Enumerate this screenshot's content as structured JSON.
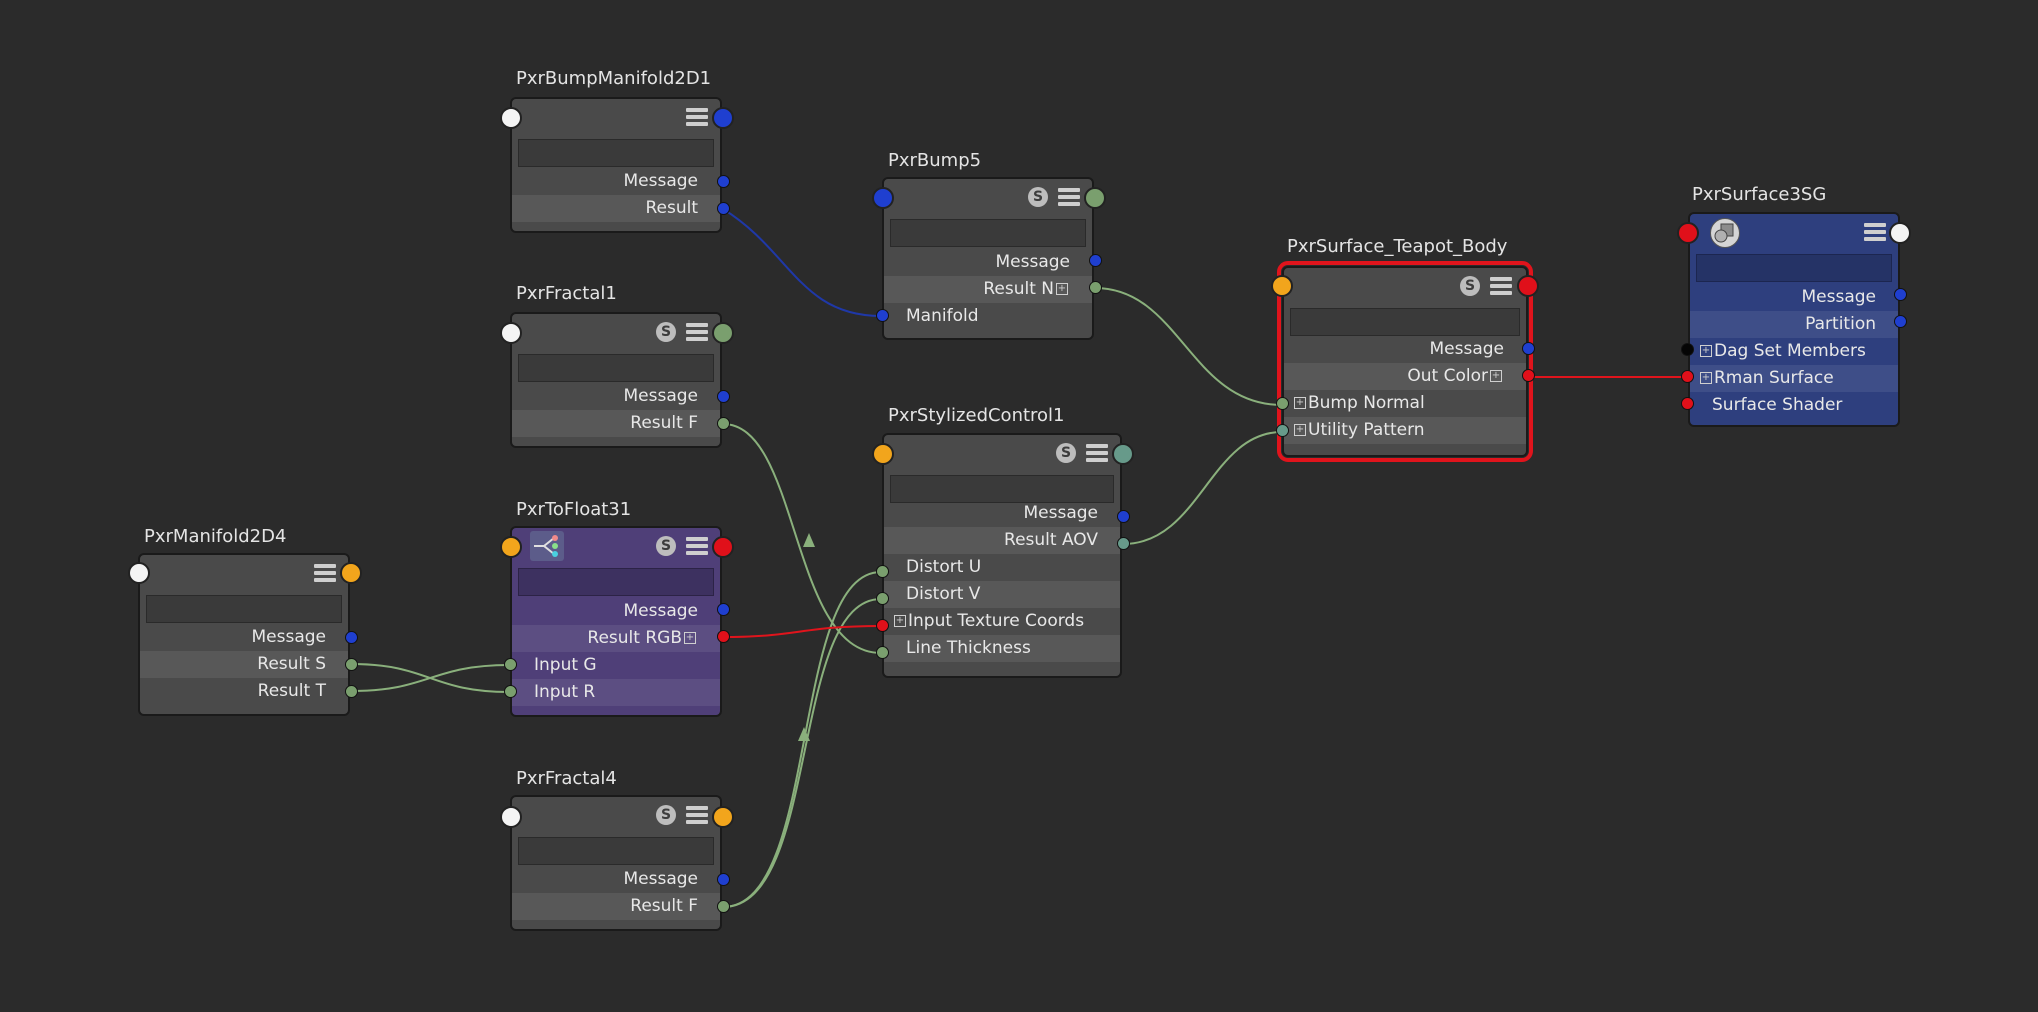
{
  "nodes": {
    "bump_manifold": {
      "title": "PxrBumpManifold2D1",
      "message": "Message",
      "result": "Result"
    },
    "fractal1": {
      "title": "PxrFractal1",
      "s": "S",
      "message": "Message",
      "result": "Result F"
    },
    "manifold2d4": {
      "title": "PxrManifold2D4",
      "message": "Message",
      "result_s": "Result S",
      "result_t": "Result T"
    },
    "tofloat": {
      "title": "PxrToFloat31",
      "s": "S",
      "message": "Message",
      "result": "Result RGB",
      "input_g": "Input G",
      "input_r": "Input R"
    },
    "fractal4": {
      "title": "PxrFractal4",
      "s": "S",
      "message": "Message",
      "result": "Result F"
    },
    "bump5": {
      "title": "PxrBump5",
      "s": "S",
      "message": "Message",
      "result": "Result N",
      "manifold": "Manifold"
    },
    "stylized": {
      "title": "PxrStylizedControl1",
      "s": "S",
      "message": "Message",
      "result": "Result AOV",
      "distort_u": "Distort U",
      "distort_v": "Distort V",
      "texture_coords": "Input Texture Coords",
      "line_thickness": "Line Thickness"
    },
    "surface": {
      "title": "PxrSurface_Teapot_Body",
      "s": "S",
      "message": "Message",
      "out_color": "Out Color",
      "bump_normal": "Bump Normal",
      "utility_pattern": "Utility Pattern"
    },
    "sg": {
      "title": "PxrSurface3SG",
      "message": "Message",
      "partition": "Partition",
      "dag_set": "Dag Set Members",
      "rman_surface": "Rman Surface",
      "surface_shader": "Surface Shader"
    }
  },
  "icons": {
    "swatch": "swatch-icon",
    "menu": "menu-icon",
    "shading_group": "shading-group-icon",
    "float_graph": "float-graph-icon"
  },
  "colors": {
    "background": "#2b2b2b",
    "node": "#4a4a4a",
    "purple_node": "#4f3f78",
    "blue_node": "#2e3f7e",
    "selected": "#e0141c",
    "wire_green": "#8ab07c",
    "wire_red": "#e0141c",
    "wire_blue": "#1f38a8"
  }
}
